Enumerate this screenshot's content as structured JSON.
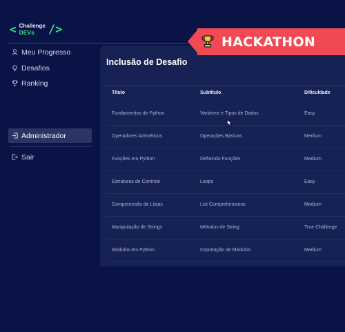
{
  "brand": {
    "line1": "Challenge",
    "line2": "DEVs",
    "bracket_left": "<",
    "bracket_right": "/>"
  },
  "sidebar": {
    "items": [
      {
        "label": "Meu Progresso",
        "icon": "user-icon"
      },
      {
        "label": "Desafios",
        "icon": "lightbulb-icon"
      },
      {
        "label": "Ranking",
        "icon": "trophy-icon"
      }
    ],
    "admin": {
      "label": "Administrador",
      "icon": "login-icon",
      "active": true
    },
    "logout": {
      "label": "Sair",
      "icon": "logout-icon"
    }
  },
  "badge": {
    "label": "HACKATHON",
    "icon": "trophy-icon",
    "color": "#f24a55"
  },
  "panel": {
    "title": "Inclusão de Desafio",
    "columns": [
      "Título",
      "Subtítulo",
      "Dificuldade"
    ],
    "rows": [
      [
        "Fundamentos de Python",
        "Variáveis e Tipos de Dados",
        "Easy"
      ],
      [
        "Operadores Aritméticos",
        "Operações Básicas",
        "Medium"
      ],
      [
        "Funções em Python",
        "Definindo Funções",
        "Medium"
      ],
      [
        "Estruturas de Controle",
        "Loops",
        "Easy"
      ],
      [
        "Compreensão de Listas",
        "List Comprehensions",
        "Medium"
      ],
      [
        "Manipulação de Strings",
        "Métodos de String",
        "True Challenge"
      ],
      [
        "Módulos em Python",
        "Importação de Módulos",
        "Medium"
      ]
    ]
  },
  "colors": {
    "background": "#0a1346",
    "panel": "#162154",
    "accent": "#3ddc84",
    "active_nav": "#2a3566"
  }
}
